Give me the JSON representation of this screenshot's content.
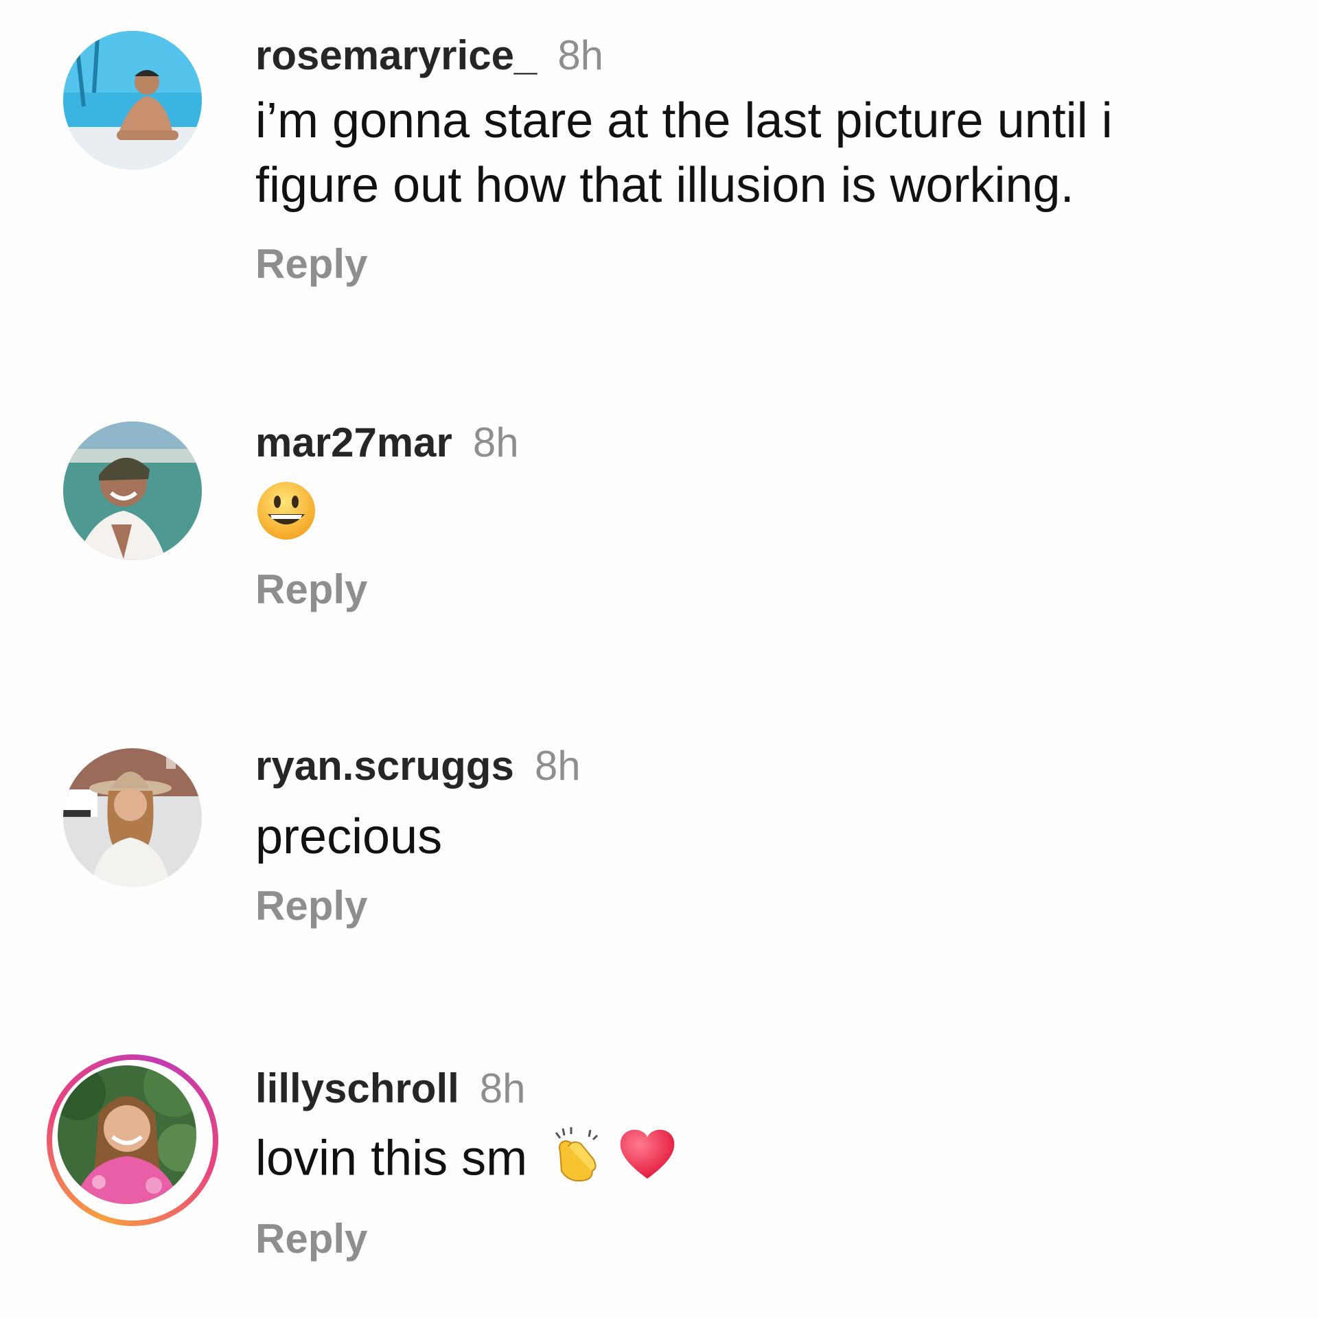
{
  "comments": [
    {
      "username": "rosemaryrice_",
      "time": "8h",
      "text": "i’m gonna stare at the last picture until i figure out how that illusion is working.",
      "reply_label": "Reply",
      "avatar_icon": "avatar-photo-pool"
    },
    {
      "username": "mar27mar",
      "time": "8h",
      "text": "",
      "emojis": [
        "grinning-face-emoji"
      ],
      "reply_label": "Reply",
      "avatar_icon": "avatar-photo-beach"
    },
    {
      "username": "ryan.scruggs",
      "time": "8h",
      "text": "precious",
      "reply_label": "Reply",
      "avatar_icon": "avatar-photo-street"
    },
    {
      "username": "lillyschroll",
      "time": "8h",
      "text": "lovin this sm",
      "emojis": [
        "clapping-hands-emoji",
        "red-heart-emoji"
      ],
      "reply_label": "Reply",
      "avatar_icon": "avatar-photo-garden",
      "has_story_ring": true
    }
  ],
  "colors": {
    "text": "#262626",
    "muted": "#8e8e8e",
    "story_ring_start": "#f9a03f",
    "story_ring_end": "#c43ab2"
  }
}
